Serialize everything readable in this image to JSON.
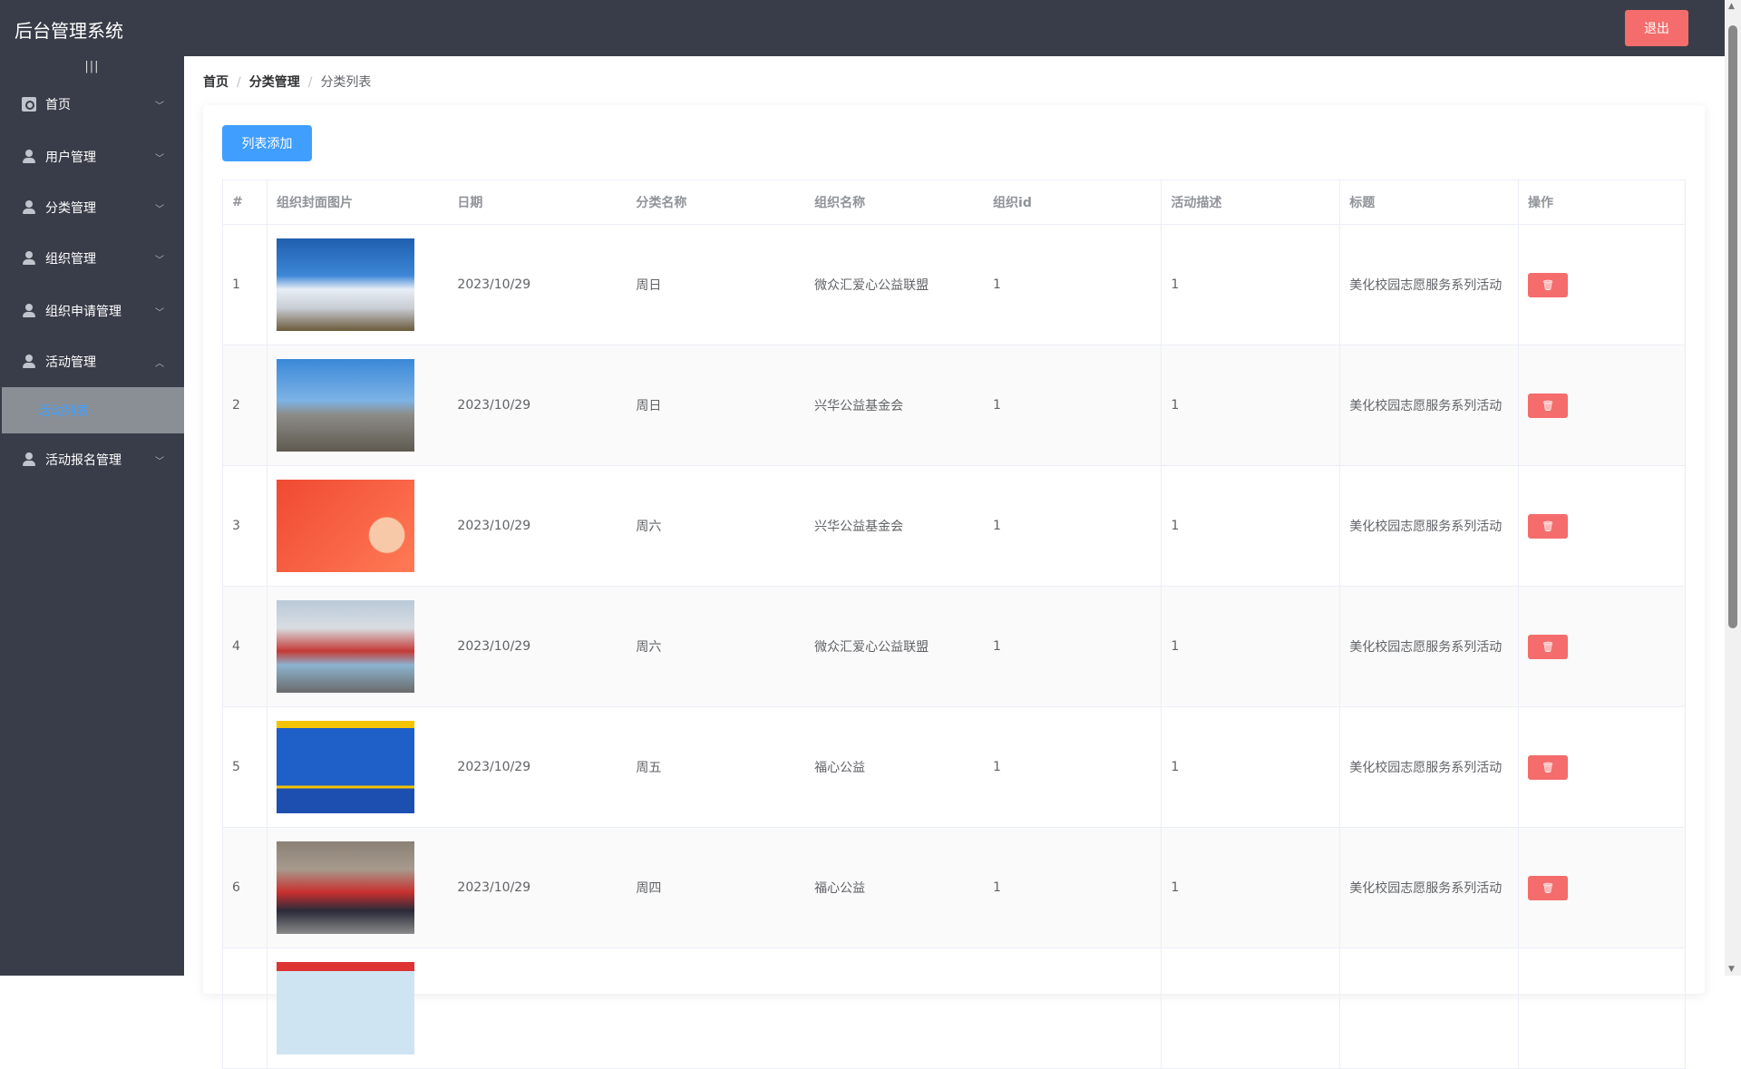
{
  "header": {
    "title": "后台管理系统",
    "exit_label": "退出"
  },
  "sidebar": {
    "collapse_icon": "|||",
    "items": [
      {
        "label": "首页",
        "icon": "home-icon",
        "expanded": false
      },
      {
        "label": "用户管理",
        "icon": "user-icon",
        "expanded": false
      },
      {
        "label": "分类管理",
        "icon": "user-icon",
        "expanded": false
      },
      {
        "label": "组织管理",
        "icon": "user-icon",
        "expanded": false
      },
      {
        "label": "组织申请管理",
        "icon": "user-icon",
        "expanded": false
      },
      {
        "label": "活动管理",
        "icon": "user-icon",
        "expanded": true
      },
      {
        "label": "活动报名管理",
        "icon": "user-icon",
        "expanded": false
      }
    ],
    "active_sub": "活动列表"
  },
  "breadcrumb": [
    "首页",
    "分类管理",
    "分类列表"
  ],
  "toolbar": {
    "add_label": "列表添加"
  },
  "table": {
    "headers": [
      "#",
      "组织封面图片",
      "日期",
      "分类名称",
      "组织名称",
      "组织id",
      "活动描述",
      "标题",
      "操作"
    ],
    "rows": [
      {
        "no": "1",
        "date": "2023/10/29",
        "category": "周日",
        "org": "微众汇爱心公益联盟",
        "org_id": "1",
        "desc": "1",
        "title": "美化校园志愿服务系列活动"
      },
      {
        "no": "2",
        "date": "2023/10/29",
        "category": "周日",
        "org": "兴华公益基金会",
        "org_id": "1",
        "desc": "1",
        "title": "美化校园志愿服务系列活动"
      },
      {
        "no": "3",
        "date": "2023/10/29",
        "category": "周六",
        "org": "兴华公益基金会",
        "org_id": "1",
        "desc": "1",
        "title": "美化校园志愿服务系列活动"
      },
      {
        "no": "4",
        "date": "2023/10/29",
        "category": "周六",
        "org": "微众汇爱心公益联盟",
        "org_id": "1",
        "desc": "1",
        "title": "美化校园志愿服务系列活动"
      },
      {
        "no": "5",
        "date": "2023/10/29",
        "category": "周五",
        "org": "福心公益",
        "org_id": "1",
        "desc": "1",
        "title": "美化校园志愿服务系列活动"
      },
      {
        "no": "6",
        "date": "2023/10/29",
        "category": "周四",
        "org": "福心公益",
        "org_id": "1",
        "desc": "1",
        "title": "美化校园志愿服务系列活动"
      }
    ]
  },
  "colors": {
    "header_bg": "#393d49",
    "primary": "#409eff",
    "danger": "#f56c6c"
  }
}
